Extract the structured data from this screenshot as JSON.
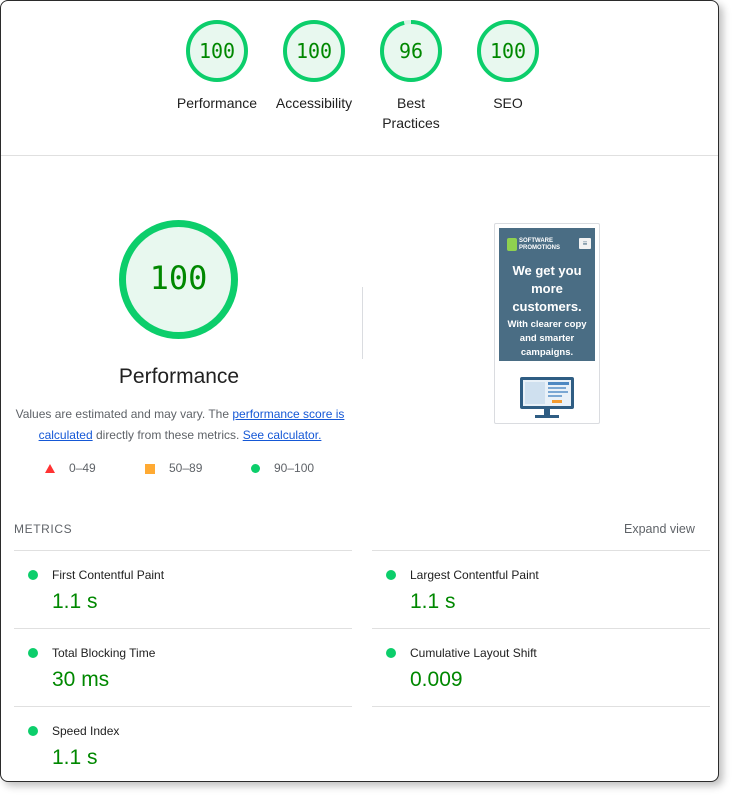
{
  "categories": [
    {
      "name": "Performance",
      "score": "100"
    },
    {
      "name": "Accessibility",
      "score": "100"
    },
    {
      "name": "Best Practices",
      "score": "96"
    },
    {
      "name": "SEO",
      "score": "100"
    }
  ],
  "main": {
    "score": "100",
    "title": "Performance",
    "desc_prefix": "Values are estimated and may vary. The ",
    "desc_link1": "performance score is calculated",
    "desc_middle": " directly from these metrics. ",
    "desc_link2": "See calculator.",
    "legend": [
      {
        "range": "0–49",
        "color": "#ff3333",
        "shape": "triangle-icon"
      },
      {
        "range": "50–89",
        "color": "#ffaa33",
        "shape": "square-icon"
      },
      {
        "range": "90–100",
        "color": "#0cce6b",
        "shape": "circle-icon"
      }
    ]
  },
  "screenshot": {
    "logo_line1": "SOFTWARE",
    "logo_line2": "PROMOTIONS",
    "headline": "We get you more customers.",
    "subheadline": "With clearer copy and smarter campaigns."
  },
  "metrics": {
    "heading": "METRICS",
    "expand_label": "Expand view",
    "items": [
      {
        "title": "First Contentful Paint",
        "value": "1.1 s"
      },
      {
        "title": "Largest Contentful Paint",
        "value": "1.1 s"
      },
      {
        "title": "Total Blocking Time",
        "value": "30 ms"
      },
      {
        "title": "Cumulative Layout Shift",
        "value": "0.009"
      },
      {
        "title": "Speed Index",
        "value": "1.1 s"
      }
    ]
  },
  "colors": {
    "pass": "#0cce6b",
    "pass_text": "#008800",
    "pass_fill": "#e8f8ef",
    "link": "#1558d6"
  }
}
